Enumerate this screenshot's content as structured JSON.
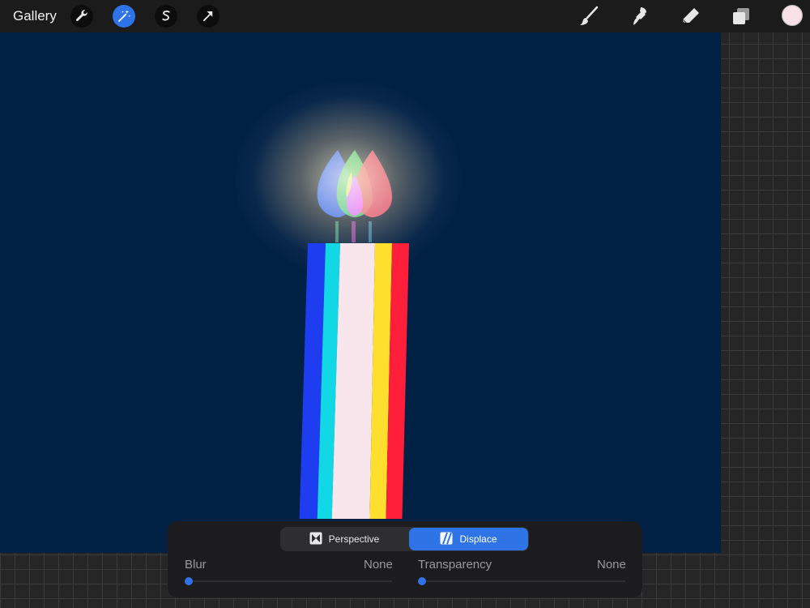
{
  "toolbar": {
    "gallery_label": "Gallery",
    "left_tools": [
      "wrench-icon",
      "magic-wand-icon",
      "selection-icon",
      "transform-arrow-icon"
    ],
    "right_tools": [
      "brush-icon",
      "smudge-icon",
      "eraser-icon",
      "layers-icon"
    ],
    "active_tool": "magic-wand-icon",
    "current_color": "#f8e0e6"
  },
  "colors": {
    "accent": "#2f74e6",
    "canvas_background": "#002044"
  },
  "adjustment_panel": {
    "modes": [
      {
        "label": "Perspective",
        "icon": "perspective-icon",
        "active": false
      },
      {
        "label": "Displace",
        "icon": "displace-icon",
        "active": true
      }
    ],
    "sliders": [
      {
        "label": "Blur",
        "value": "None",
        "level": 0
      },
      {
        "label": "Transparency",
        "value": "None",
        "level": 0
      }
    ]
  }
}
